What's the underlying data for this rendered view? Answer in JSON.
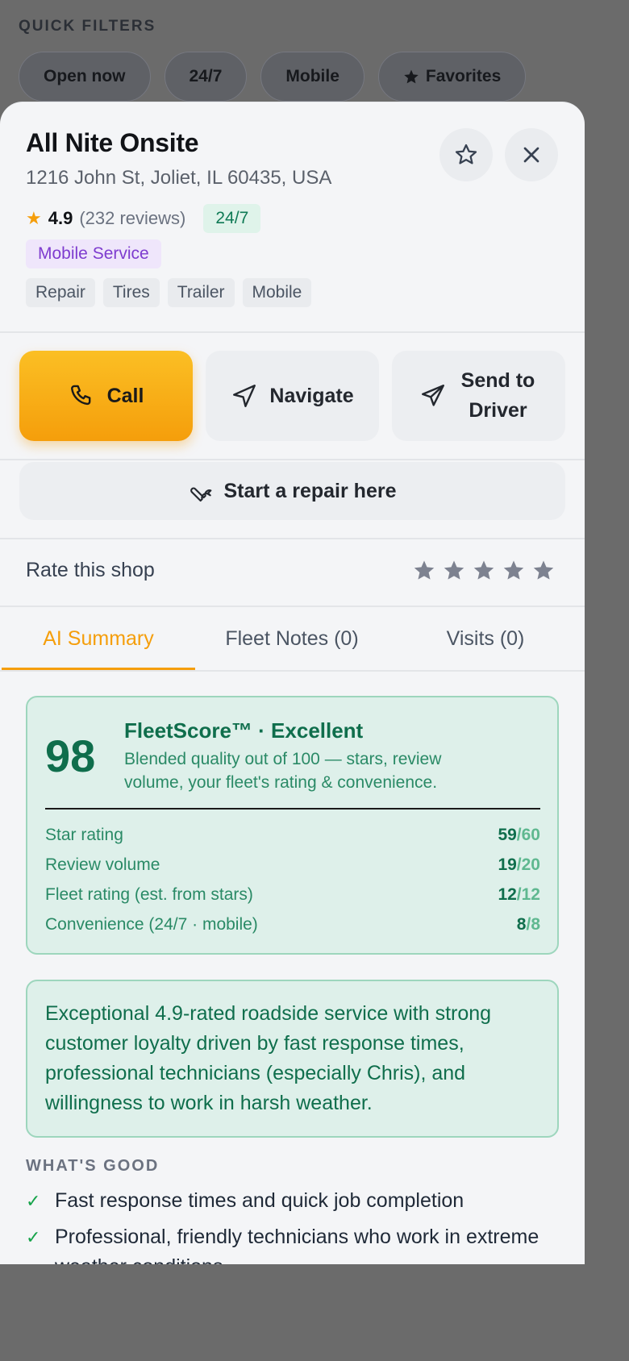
{
  "quick_filters": {
    "title": "QUICK FILTERS",
    "chips": [
      "Open now",
      "24/7",
      "Mobile",
      "Favorites"
    ]
  },
  "shop": {
    "name": "All Nite Onsite",
    "address": "1216 John St, Joliet, IL 60435, USA",
    "rating": "4.9",
    "reviews": "(232 reviews)",
    "hours_badge": "24/7",
    "service_badge": "Mobile Service",
    "tags": [
      "Repair",
      "Tires",
      "Trailer",
      "Mobile"
    ]
  },
  "actions": {
    "call": "Call",
    "navigate": "Navigate",
    "send_line1": "Send to",
    "send_line2": "Driver",
    "repair": "Start a repair here"
  },
  "rate": {
    "label": "Rate this shop",
    "stars_filled": 0,
    "stars_total": 5
  },
  "tabs": [
    "AI Summary",
    "Fleet Notes (0)",
    "Visits (0)"
  ],
  "fleetscore": {
    "score": "98",
    "title": "FleetScore™ · Excellent",
    "description": "Blended quality out of 100 — stars, review volume, your fleet's rating & convenience.",
    "rows": [
      {
        "label": "Star rating",
        "value": "59",
        "max": "/60"
      },
      {
        "label": "Review volume",
        "value": "19",
        "max": "/20"
      },
      {
        "label": "Fleet rating (est. from stars)",
        "value": "12",
        "max": "/12"
      },
      {
        "label": "Convenience (24/7 · mobile)",
        "value": "8",
        "max": "/8"
      }
    ]
  },
  "summary": "Exceptional 4.9-rated roadside service with strong customer loyalty driven by fast response times, professional technicians (especially Chris), and willingness to work in harsh weather.",
  "whats_good": {
    "title": "WHAT'S GOOD",
    "items": [
      "Fast response times and quick job completion",
      "Professional, friendly technicians who work in extreme weather conditions"
    ]
  },
  "colors": {
    "accent": "#f59e0b",
    "success": "#0f6e4c",
    "purple": "#7e3ccf"
  }
}
